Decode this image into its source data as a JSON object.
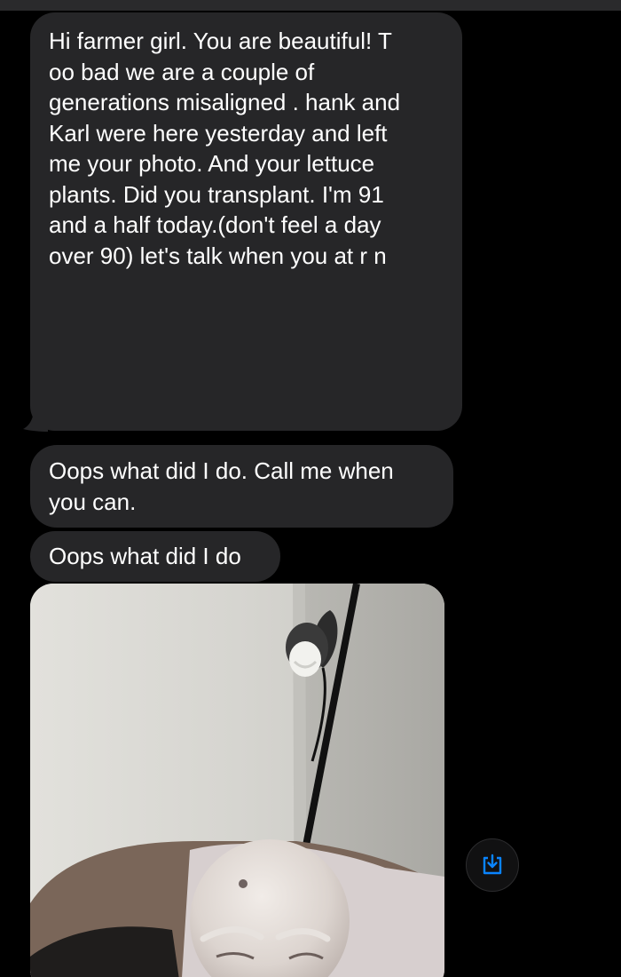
{
  "conversation": {
    "messages": [
      {
        "type": "text",
        "text": "Hi farmer girl. You are beautiful! T\noo bad we are a couple of\ngenerations misaligned . hank and\nKarl were here yesterday and left\nme your photo. And your lettuce\nplants. Did you transplant. I'm 91\nand a half today.(don't feel a day\nover 90) let's talk when you at r n"
      },
      {
        "type": "text",
        "text": "Oops what did I do. Call me when\nyou can."
      },
      {
        "type": "text",
        "text": "Oops what did I do"
      },
      {
        "type": "photo",
        "icon": "selfie-photo"
      }
    ],
    "actions": {
      "save_icon": "save-download-icon"
    }
  },
  "colors": {
    "background": "#000000",
    "bubble": "#262628",
    "text": "#ffffff",
    "accent": "#0a84ff"
  }
}
